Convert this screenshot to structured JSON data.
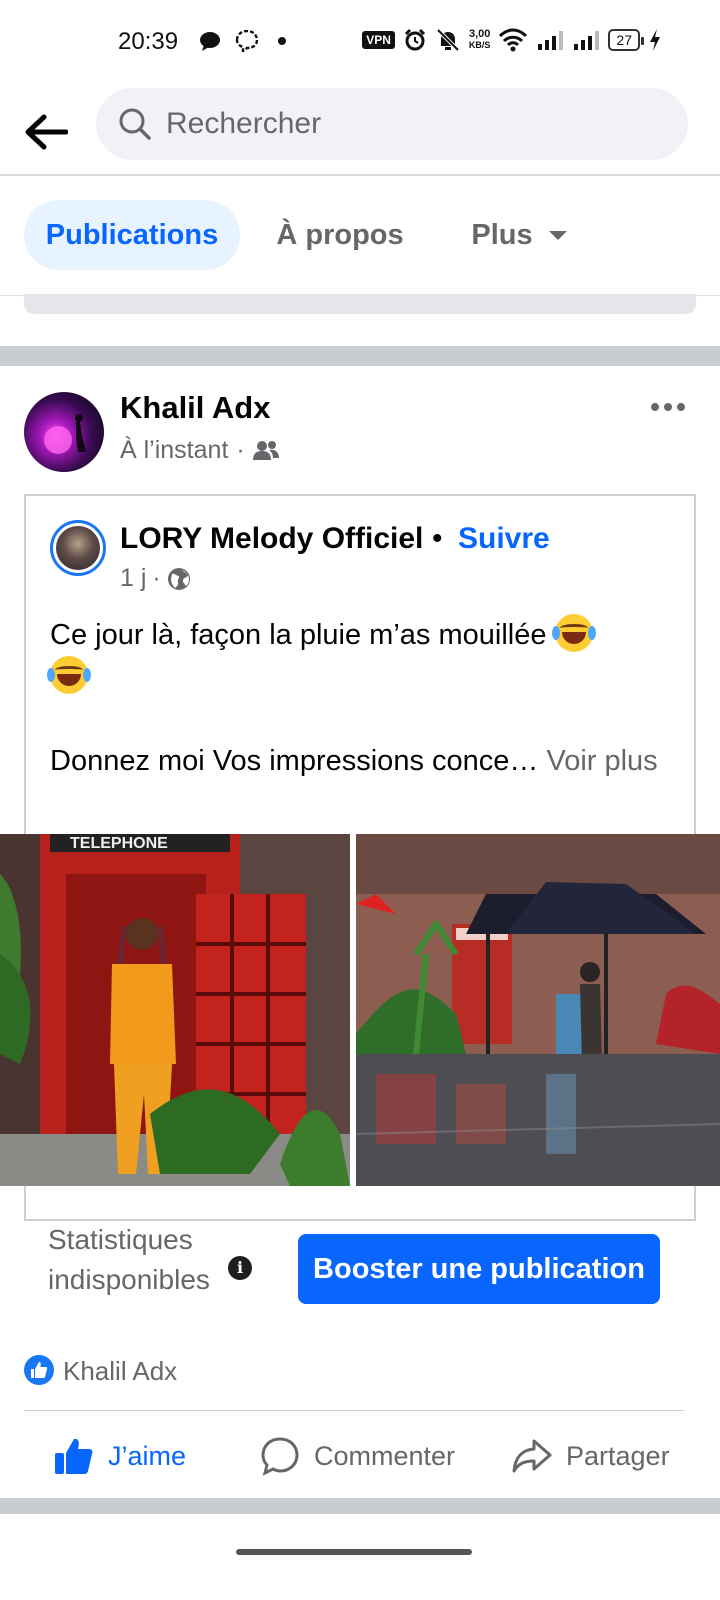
{
  "status_bar": {
    "time": "20:39",
    "vpn": "VPN",
    "speed_value": "3,00",
    "speed_unit": "KB/S",
    "battery": "27"
  },
  "search": {
    "placeholder": "Rechercher"
  },
  "tabs": [
    {
      "label": "Publications",
      "active": true
    },
    {
      "label": "À propos",
      "active": false
    },
    {
      "label": "Plus",
      "active": false
    }
  ],
  "post": {
    "author": "Khalil Adx",
    "time": "À l’instant",
    "separator": "·",
    "shared": {
      "page_name": "LORY Melody Officiel",
      "dot": "•",
      "follow_label": "Suivre",
      "time": "1 j",
      "separator": "·",
      "text_line1": "Ce jour là, façon la pluie m’as mouillée",
      "text_line2": "Donnez moi Vos impressions conce…",
      "see_more": "Voir plus"
    },
    "stats_text": "Statistiques indisponibles",
    "boost_label": "Booster une publication",
    "reactor": "Khalil Adx",
    "actions": {
      "like": "J’aime",
      "comment": "Commenter",
      "share": "Partager"
    }
  },
  "colors": {
    "accent": "#0866ff",
    "secondary_text": "#65676b",
    "tab_active_bg": "#e7f3ff"
  }
}
